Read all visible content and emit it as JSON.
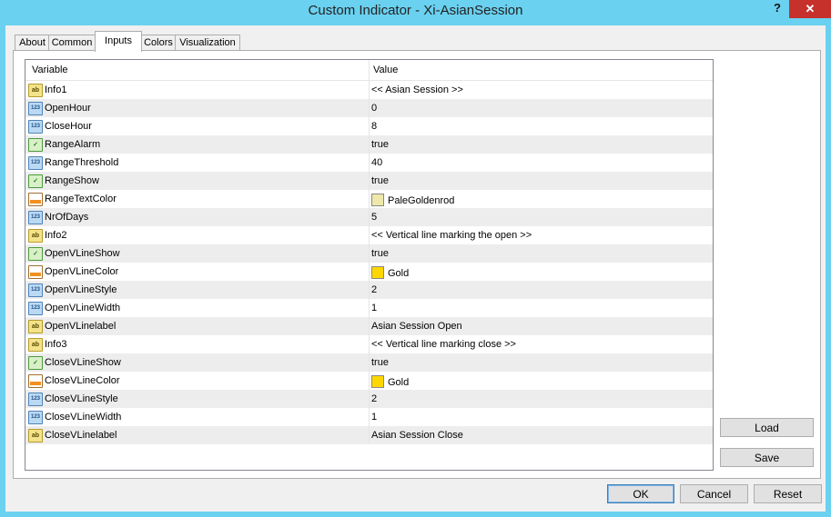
{
  "window": {
    "title": "Custom Indicator - Xi-AsianSession",
    "help_label": "?",
    "close_label": "✕"
  },
  "tabs": [
    {
      "label": "About"
    },
    {
      "label": "Common"
    },
    {
      "label": "Inputs",
      "active": true
    },
    {
      "label": "Colors"
    },
    {
      "label": "Visualization"
    }
  ],
  "grid": {
    "headers": {
      "variable": "Variable",
      "value": "Value"
    },
    "rows": [
      {
        "type": "string",
        "name": "Info1",
        "value": "<< Asian Session >>"
      },
      {
        "type": "int",
        "name": "OpenHour",
        "value": "0"
      },
      {
        "type": "int",
        "name": "CloseHour",
        "value": "8"
      },
      {
        "type": "bool",
        "name": "RangeAlarm",
        "value": "true"
      },
      {
        "type": "int",
        "name": "RangeThreshold",
        "value": "40"
      },
      {
        "type": "bool",
        "name": "RangeShow",
        "value": "true"
      },
      {
        "type": "color",
        "name": "RangeTextColor",
        "value": "PaleGoldenrod",
        "swatch": "#eee8aa"
      },
      {
        "type": "int",
        "name": "NrOfDays",
        "value": "5"
      },
      {
        "type": "string",
        "name": "Info2",
        "value": "<< Vertical line marking the open >>"
      },
      {
        "type": "bool",
        "name": "OpenVLineShow",
        "value": "true"
      },
      {
        "type": "color",
        "name": "OpenVLineColor",
        "value": "Gold",
        "swatch": "#ffd700"
      },
      {
        "type": "int",
        "name": "OpenVLineStyle",
        "value": "2"
      },
      {
        "type": "int",
        "name": "OpenVLineWidth",
        "value": "1"
      },
      {
        "type": "string",
        "name": "OpenVLinelabel",
        "value": "Asian Session Open"
      },
      {
        "type": "string",
        "name": "Info3",
        "value": "<< Vertical line marking close >>"
      },
      {
        "type": "bool",
        "name": "CloseVLineShow",
        "value": "true"
      },
      {
        "type": "color",
        "name": "CloseVLineColor",
        "value": "Gold",
        "swatch": "#ffd700"
      },
      {
        "type": "int",
        "name": "CloseVLineStyle",
        "value": "2"
      },
      {
        "type": "int",
        "name": "CloseVLineWidth",
        "value": "1"
      },
      {
        "type": "string",
        "name": "CloseVLinelabel",
        "value": "Asian Session Close"
      }
    ]
  },
  "side_buttons": {
    "load": "Load",
    "save": "Save"
  },
  "footer_buttons": {
    "ok": "OK",
    "cancel": "Cancel",
    "reset": "Reset"
  },
  "icon_glyphs": {
    "string": "ab",
    "int": "123",
    "bool": "✓",
    "color": ""
  }
}
